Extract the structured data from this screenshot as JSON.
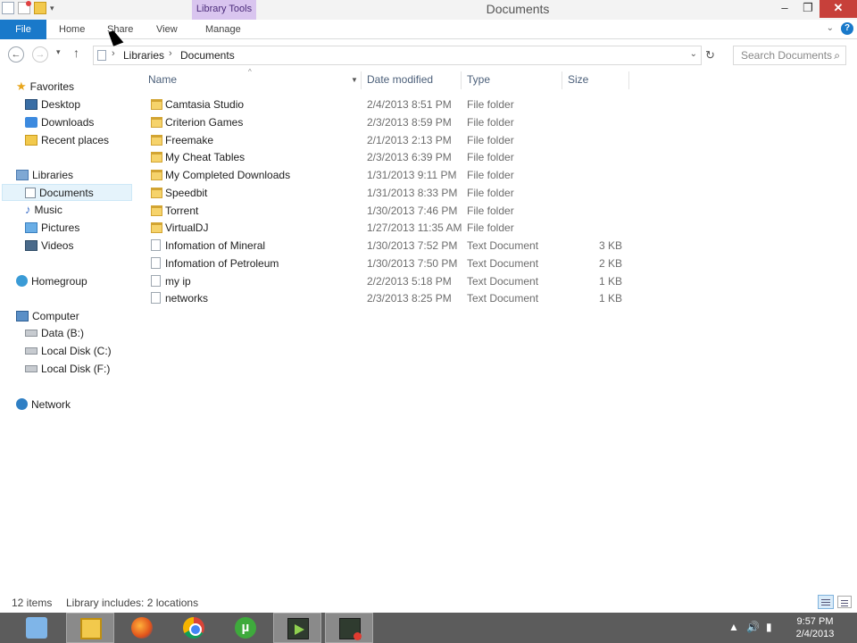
{
  "window": {
    "title": "Documents",
    "contextual_tab": "Library Tools",
    "buttons": {
      "minimize": "–",
      "restore": "❐",
      "close": "✕"
    }
  },
  "ribbon": {
    "tabs": [
      "File",
      "Home",
      "Share",
      "View",
      "Manage"
    ],
    "help_icon": "?"
  },
  "address": {
    "crumbs": [
      "Libraries",
      "Documents"
    ],
    "search_placeholder": "Search Documents"
  },
  "nav": {
    "favorites": {
      "label": "Favorites",
      "items": [
        "Desktop",
        "Downloads",
        "Recent places"
      ]
    },
    "libraries": {
      "label": "Libraries",
      "items": [
        "Documents",
        "Music",
        "Pictures",
        "Videos"
      ],
      "selected": "Documents"
    },
    "homegroup": {
      "label": "Homegroup"
    },
    "computer": {
      "label": "Computer",
      "items": [
        "Data (B:)",
        "Local Disk (C:)",
        "Local Disk (F:)"
      ]
    },
    "network": {
      "label": "Network"
    }
  },
  "columns": {
    "name": "Name",
    "date": "Date modified",
    "type": "Type",
    "size": "Size"
  },
  "files": [
    {
      "name": "Camtasia Studio",
      "date": "2/4/2013 8:51 PM",
      "type": "File folder",
      "size": "",
      "kind": "folder"
    },
    {
      "name": "Criterion Games",
      "date": "2/3/2013 8:59 PM",
      "type": "File folder",
      "size": "",
      "kind": "folder"
    },
    {
      "name": "Freemake",
      "date": "2/1/2013 2:13 PM",
      "type": "File folder",
      "size": "",
      "kind": "folder"
    },
    {
      "name": "My Cheat Tables",
      "date": "2/3/2013 6:39 PM",
      "type": "File folder",
      "size": "",
      "kind": "folder"
    },
    {
      "name": "My Completed Downloads",
      "date": "1/31/2013 9:11 PM",
      "type": "File folder",
      "size": "",
      "kind": "folder"
    },
    {
      "name": "Speedbit",
      "date": "1/31/2013 8:33 PM",
      "type": "File folder",
      "size": "",
      "kind": "folder"
    },
    {
      "name": "Torrent",
      "date": "1/30/2013 7:46 PM",
      "type": "File folder",
      "size": "",
      "kind": "folder"
    },
    {
      "name": "VirtualDJ",
      "date": "1/27/2013 11:35 AM",
      "type": "File folder",
      "size": "",
      "kind": "folder"
    },
    {
      "name": "Infomation of Mineral",
      "date": "1/30/2013 7:52 PM",
      "type": "Text Document",
      "size": "3 KB",
      "kind": "text"
    },
    {
      "name": "Infomation of Petroleum",
      "date": "1/30/2013 7:50 PM",
      "type": "Text Document",
      "size": "2 KB",
      "kind": "text"
    },
    {
      "name": "my ip",
      "date": "2/2/2013 5:18 PM",
      "type": "Text Document",
      "size": "1 KB",
      "kind": "text"
    },
    {
      "name": "networks",
      "date": "2/3/2013 8:25 PM",
      "type": "Text Document",
      "size": "1 KB",
      "kind": "text"
    }
  ],
  "status": {
    "count": "12 items",
    "library": "Library includes: 2 locations"
  },
  "taskbar": {
    "apps": [
      "internet-explorer-icon",
      "file-explorer-icon",
      "firefox-icon",
      "chrome-icon",
      "utorrent-icon",
      "camtasia-studio-icon",
      "camtasia-recorder-icon"
    ],
    "clock_time": "9:57 PM",
    "clock_date": "2/4/2013"
  }
}
